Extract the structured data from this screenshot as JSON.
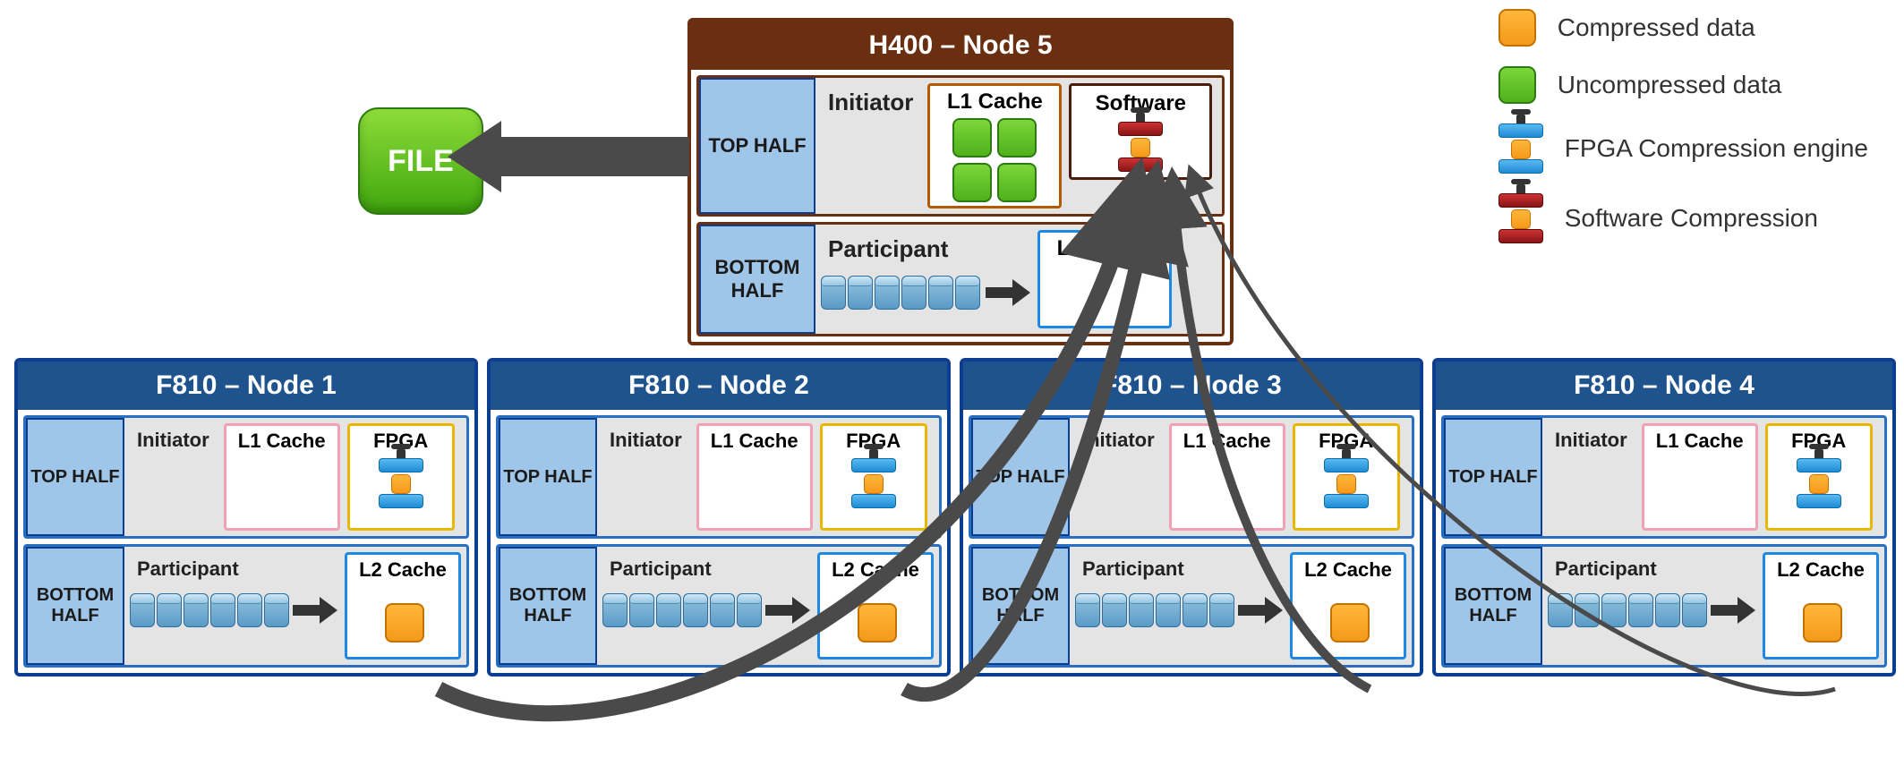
{
  "legend": {
    "compressed": "Compressed data",
    "uncompressed": "Uncompressed data",
    "fpga": "FPGA Compression engine",
    "software": "Software Compression"
  },
  "file_label": "FILE",
  "h400": {
    "title": "H400 – Node 5",
    "top_half": "TOP HALF",
    "bottom_half": "BOTTOM HALF",
    "initiator": "Initiator",
    "participant": "Participant",
    "l1cache": "L1 Cache",
    "software": "Software",
    "l2cache": "L2 Cache"
  },
  "labels": {
    "top_half": "TOP HALF",
    "bottom_half": "BOTTOM HALF",
    "initiator": "Initiator",
    "participant": "Participant",
    "l1cache": "L1 Cache",
    "fpga": "FPGA",
    "l2cache": "L2 Cache"
  },
  "nodes": [
    {
      "title": "F810 – Node 1"
    },
    {
      "title": "F810 – Node 2"
    },
    {
      "title": "F810 – Node 3"
    },
    {
      "title": "F810 – Node 4"
    }
  ]
}
